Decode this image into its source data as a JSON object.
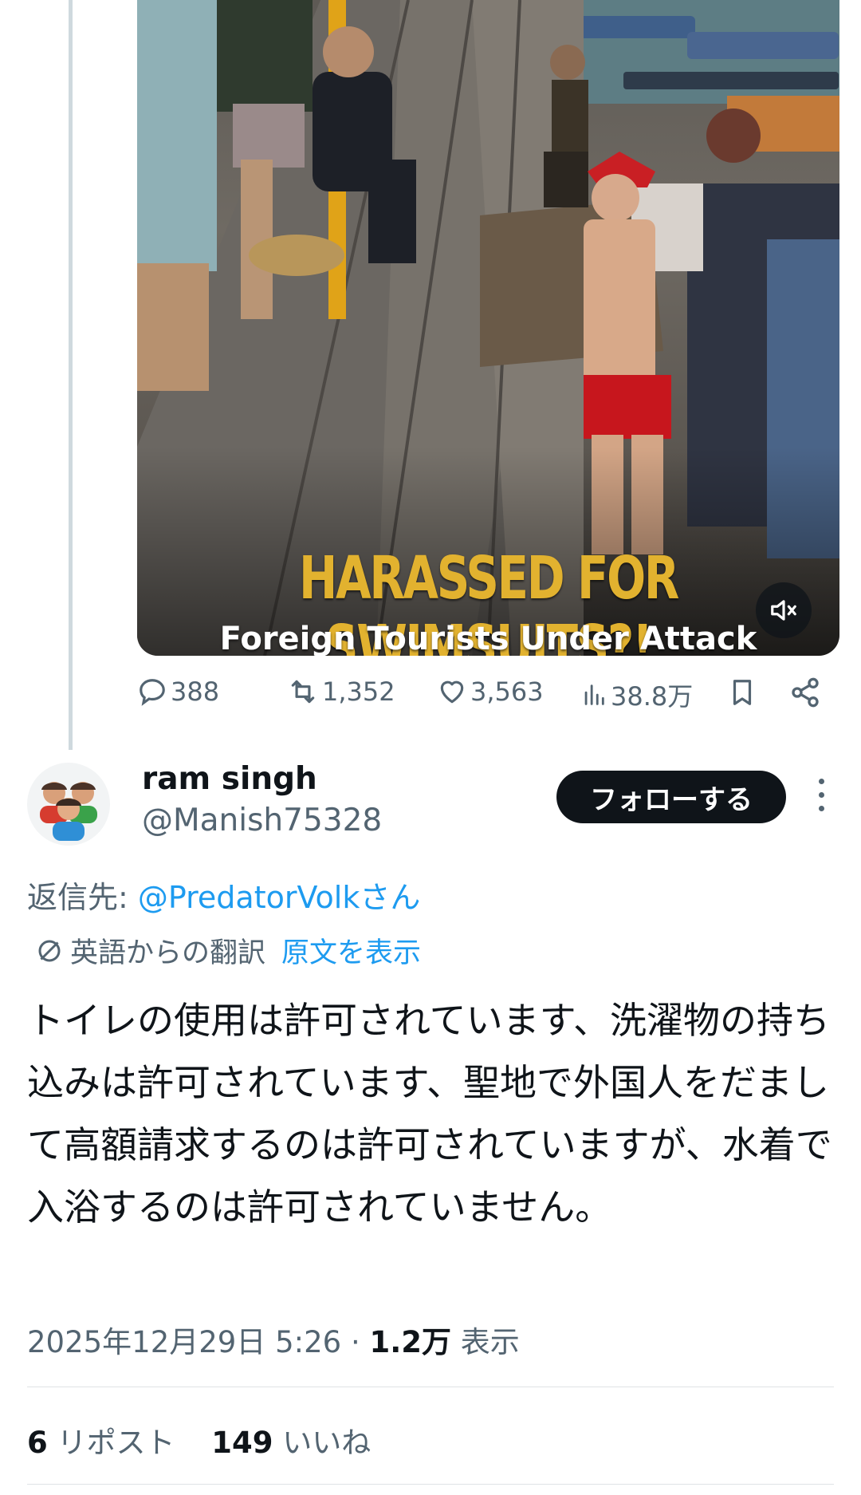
{
  "video": {
    "caption_main": "HARASSED FOR SWIMSUITS?!",
    "caption_sub": "Foreign Tourists Under Attack"
  },
  "actions": {
    "replies": "388",
    "reposts": "1,352",
    "likes": "3,563",
    "views": "38.8万"
  },
  "reply": {
    "display_name": "ram singh",
    "handle": "@Manish75328",
    "follow_label": "フォローする",
    "replying_to_prefix": "返信先: ",
    "replying_to": "@PredatorVolkさん",
    "translation_label": "英語からの翻訳",
    "show_original": "原文を表示",
    "text": "トイレの使用は許可されています、洗濯物の持ち込みは許可されています、聖地で外国人をだまして高額請求するのは許可されていますが、水着で入浴するのは許可されていません。",
    "timestamp": "2025年12月29日 5:26",
    "views_sep": " · ",
    "views_count": "1.2万",
    "views_label": " 表示",
    "reposts_count": "6",
    "reposts_label": " リポスト",
    "likes_count": "149",
    "likes_label": " いいね"
  },
  "colors": {
    "accent": "#1d9bf0",
    "muted": "#536471",
    "caption_yellow": "#e2b22f"
  }
}
